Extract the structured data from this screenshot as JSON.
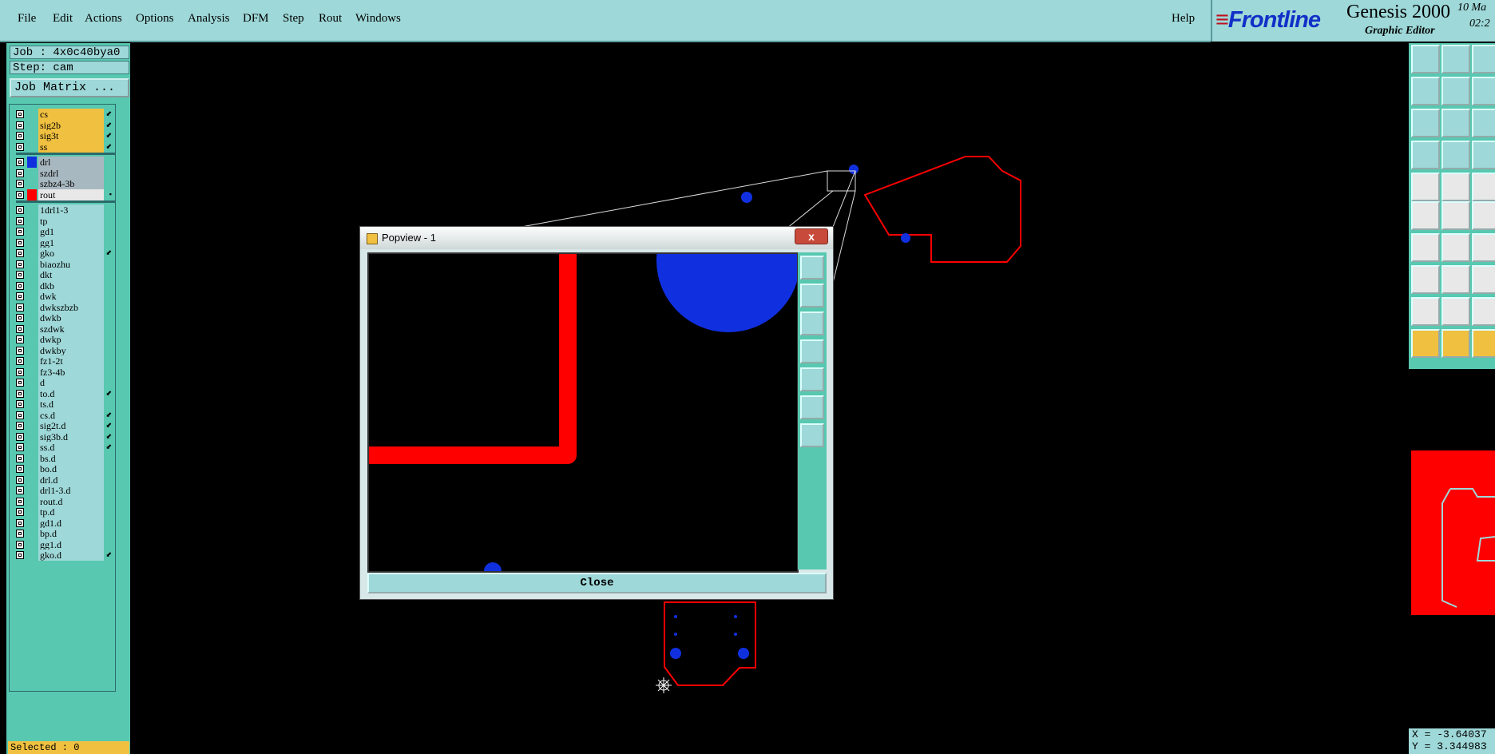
{
  "menubar": {
    "items": [
      "File",
      "Edit",
      "Actions",
      "Options",
      "Analysis",
      "DFM",
      "Step",
      "Rout",
      "Windows"
    ],
    "help": "Help"
  },
  "brand": {
    "logo": "Frontline",
    "product": "Genesis 2000",
    "subtitle": "Graphic Editor",
    "date": "10 Ma",
    "time": "02:2"
  },
  "job": {
    "job_label": "Job : 4x0c40bya0",
    "step_label": "Step: cam",
    "matrix_button": "Job Matrix ..."
  },
  "layers": [
    {
      "name": "cs",
      "color": "#f0c040",
      "mark": "⬋"
    },
    {
      "name": "sig2b",
      "color": "#f0c040",
      "mark": "⬋"
    },
    {
      "name": "sig3t",
      "color": "#f0c040",
      "mark": "⬋"
    },
    {
      "name": "ss",
      "color": "#f0c040",
      "mark": "⬋"
    },
    {
      "name": "drl",
      "color": "#a8b8c0",
      "swatch": "#1030e0"
    },
    {
      "name": "szdrl",
      "color": "#a8b8c0"
    },
    {
      "name": "szbz4-3b",
      "color": "#a8b8c0"
    },
    {
      "name": "rout",
      "color": "#e8e8e8",
      "swatch": "#ff0000",
      "mark": "▪"
    },
    {
      "name": "1drl1-3",
      "color": "#9ed8d8"
    },
    {
      "name": "tp",
      "color": "#9ed8d8"
    },
    {
      "name": "gd1",
      "color": "#9ed8d8"
    },
    {
      "name": "gg1",
      "color": "#9ed8d8"
    },
    {
      "name": "gko",
      "color": "#9ed8d8",
      "mark": "⬋"
    },
    {
      "name": "biaozhu",
      "color": "#9ed8d8"
    },
    {
      "name": "dkt",
      "color": "#9ed8d8"
    },
    {
      "name": "dkb",
      "color": "#9ed8d8"
    },
    {
      "name": "dwk",
      "color": "#9ed8d8"
    },
    {
      "name": "dwkszbzb",
      "color": "#9ed8d8"
    },
    {
      "name": "dwkb",
      "color": "#9ed8d8"
    },
    {
      "name": "szdwk",
      "color": "#9ed8d8"
    },
    {
      "name": "dwkp",
      "color": "#9ed8d8"
    },
    {
      "name": "dwkby",
      "color": "#9ed8d8"
    },
    {
      "name": "fz1-2t",
      "color": "#9ed8d8"
    },
    {
      "name": "fz3-4b",
      "color": "#9ed8d8"
    },
    {
      "name": "d",
      "color": "#9ed8d8"
    },
    {
      "name": "to.d",
      "color": "#9ed8d8",
      "mark": "⬋"
    },
    {
      "name": "ts.d",
      "color": "#9ed8d8"
    },
    {
      "name": "cs.d",
      "color": "#9ed8d8",
      "mark": "⬋"
    },
    {
      "name": "sig2t.d",
      "color": "#9ed8d8",
      "mark": "⬋"
    },
    {
      "name": "sig3b.d",
      "color": "#9ed8d8",
      "mark": "⬋"
    },
    {
      "name": "ss.d",
      "color": "#9ed8d8",
      "mark": "⬋"
    },
    {
      "name": "bs.d",
      "color": "#9ed8d8"
    },
    {
      "name": "bo.d",
      "color": "#9ed8d8"
    },
    {
      "name": "drl.d",
      "color": "#9ed8d8"
    },
    {
      "name": "drl1-3.d",
      "color": "#9ed8d8"
    },
    {
      "name": "rout.d",
      "color": "#9ed8d8"
    },
    {
      "name": "tp.d",
      "color": "#9ed8d8"
    },
    {
      "name": "gd1.d",
      "color": "#9ed8d8"
    },
    {
      "name": "bp.d",
      "color": "#9ed8d8"
    },
    {
      "name": "gg1.d",
      "color": "#9ed8d8"
    },
    {
      "name": "gko.d",
      "color": "#9ed8d8",
      "mark": "⬋"
    }
  ],
  "status": {
    "selected": "Selected : 0",
    "x": "X = -3.64037",
    "y": "Y = 3.344983"
  },
  "popview": {
    "title": "Popview - 1",
    "close_x": "x",
    "close_button": "Close"
  },
  "colors": {
    "panel": "#58c8b0",
    "menubar": "#9ed8d8",
    "rout": "#ff0000",
    "drill": "#1030e0"
  }
}
